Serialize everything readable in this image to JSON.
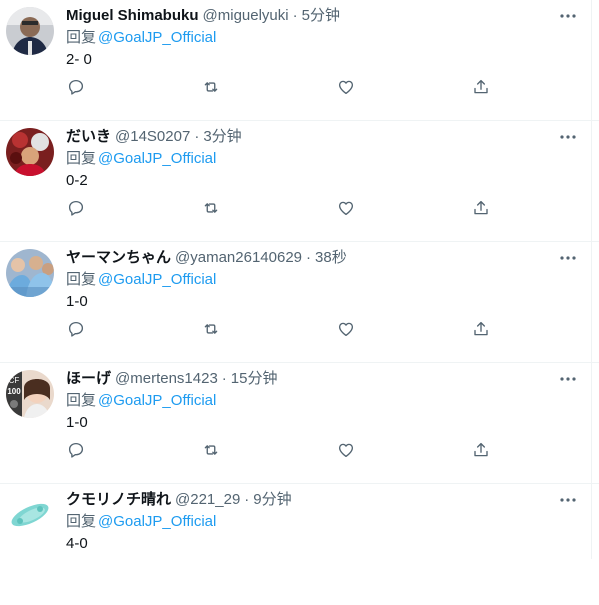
{
  "colors": {
    "name": "#0f1419",
    "secondary": "#536471",
    "mention": "#1d9bf0",
    "divider": "#eff3f4"
  },
  "icons": {
    "more": "more-horizontal-icon",
    "reply": "reply-icon",
    "retweet": "retweet-icon",
    "like": "like-icon",
    "share": "share-icon"
  },
  "tweets": [
    {
      "name": "Miguel Shimabuku",
      "handle": "@miguelyuki",
      "separator": "·",
      "time": "5分钟",
      "reply_prefix": "回复",
      "reply_to": "@GoalJP_Official",
      "text": "2- 0"
    },
    {
      "name": "だいき",
      "handle": "@14S0207",
      "separator": "·",
      "time": "3分钟",
      "reply_prefix": "回复",
      "reply_to": "@GoalJP_Official",
      "text": "0-2"
    },
    {
      "name": "ヤーマンちゃん",
      "handle": "@yaman26140629",
      "separator": "·",
      "time": "38秒",
      "reply_prefix": "回复",
      "reply_to": "@GoalJP_Official",
      "text": "1-0"
    },
    {
      "name": "ほーげ",
      "handle": "@mertens1423",
      "separator": "·",
      "time": "15分钟",
      "reply_prefix": "回复",
      "reply_to": "@GoalJP_Official",
      "text": "1-0",
      "avatar_badge_top": "CF",
      "avatar_badge_num": "100"
    },
    {
      "name": "クモリノチ晴れ",
      "handle": "@221_29",
      "separator": "·",
      "time": "9分钟",
      "reply_prefix": "回复",
      "reply_to": "@GoalJP_Official",
      "text": "4-0"
    }
  ]
}
